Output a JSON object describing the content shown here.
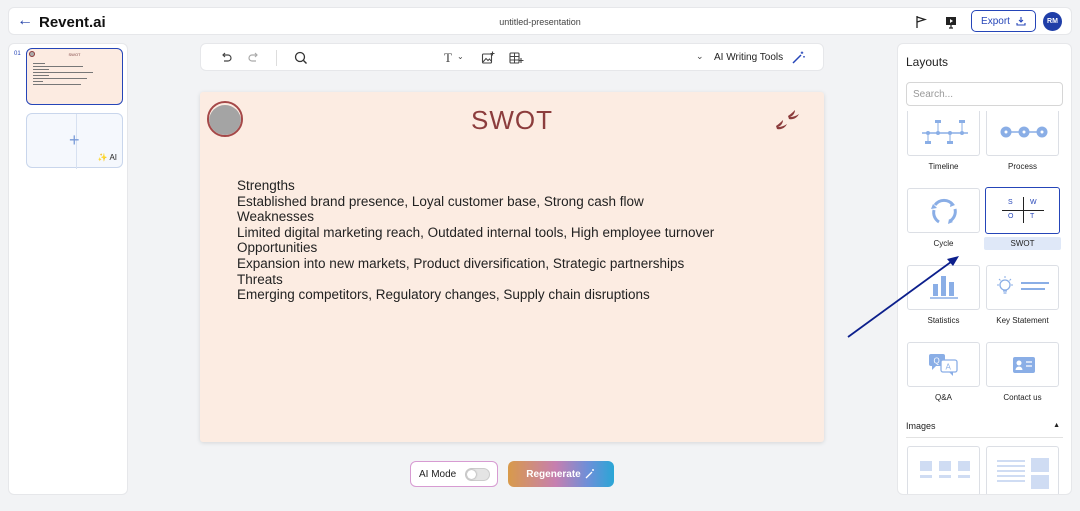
{
  "header": {
    "back_icon": "back-arrow-icon",
    "brand": "Revent.ai",
    "doc_title": "untitled-presentation",
    "export_label": "Export",
    "avatar_initials": "RM"
  },
  "slides_panel": {
    "slide_number": "01",
    "thumb_title": "SWOT",
    "add_label": "AI"
  },
  "toolbar": {
    "ai_writing_tools": "AI Writing Tools"
  },
  "slide": {
    "title": "SWOT",
    "lines": [
      "Strengths",
      "Established brand presence, Loyal customer base, Strong cash flow",
      "Weaknesses",
      "Limited digital marketing reach, Outdated internal tools,  High employee turnover",
      "Opportunities",
      "Expansion into new markets, Product diversification, Strategic partnerships",
      "Threats",
      "Emerging competitors, Regulatory changes, Supply chain disruptions"
    ],
    "background": "#fcece2",
    "title_color": "#8c3d3d"
  },
  "bottom": {
    "ai_mode_label": "AI Mode",
    "ai_mode_on": false,
    "regenerate_label": "Regenerate"
  },
  "layouts_panel": {
    "title": "Layouts",
    "search_placeholder": "Search...",
    "items": [
      {
        "label": "Timeline",
        "icon": "timeline-icon"
      },
      {
        "label": "Process",
        "icon": "process-icon"
      },
      {
        "label": "Cycle",
        "icon": "cycle-icon"
      },
      {
        "label": "SWOT",
        "icon": "swot-icon",
        "selected": true
      },
      {
        "label": "Statistics",
        "icon": "bar-chart-icon"
      },
      {
        "label": "Key Statement",
        "icon": "lightbulb-icon"
      },
      {
        "label": "Q&A",
        "icon": "qa-icon"
      },
      {
        "label": "Contact us",
        "icon": "contact-card-icon"
      }
    ],
    "swot_letters": [
      "S",
      "W",
      "O",
      "T"
    ],
    "images_heading": "Images"
  },
  "colors": {
    "accent": "#2545b8",
    "arrow": "#0c1f8c"
  }
}
